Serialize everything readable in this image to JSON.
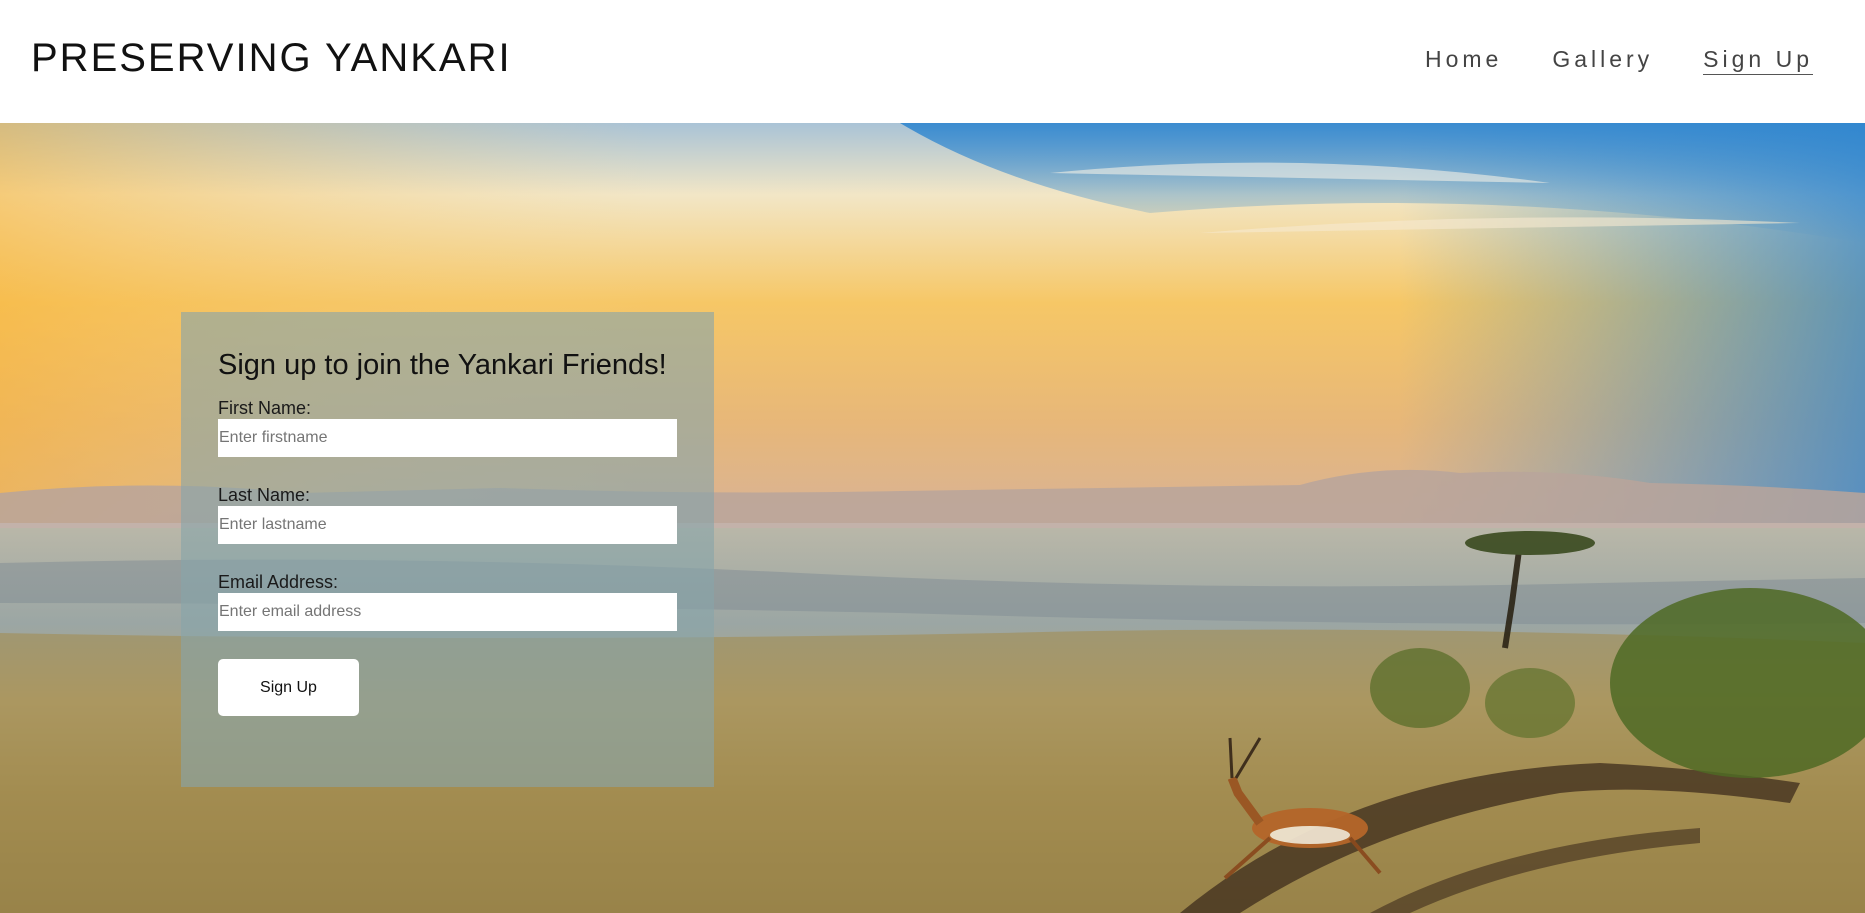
{
  "header": {
    "title": "PRESERVING YANKARI"
  },
  "nav": {
    "items": [
      {
        "label": "Home",
        "active": false
      },
      {
        "label": "Gallery",
        "active": false
      },
      {
        "label": "Sign Up",
        "active": true
      }
    ]
  },
  "form": {
    "title": "Sign up to join the Yankari Friends!",
    "first_name_label": "First Name:",
    "first_name_placeholder": "Enter firstname",
    "first_name_value": "",
    "last_name_label": "Last Name:",
    "last_name_placeholder": "Enter lastname",
    "last_name_value": "",
    "email_label": "Email Address:",
    "email_placeholder": "Enter email address",
    "email_value": "",
    "submit_label": "Sign Up"
  },
  "colors": {
    "header_bg": "#ffffff",
    "panel_overlay": "#87a5aa",
    "nav_text": "#444444",
    "title_text": "#111111"
  }
}
